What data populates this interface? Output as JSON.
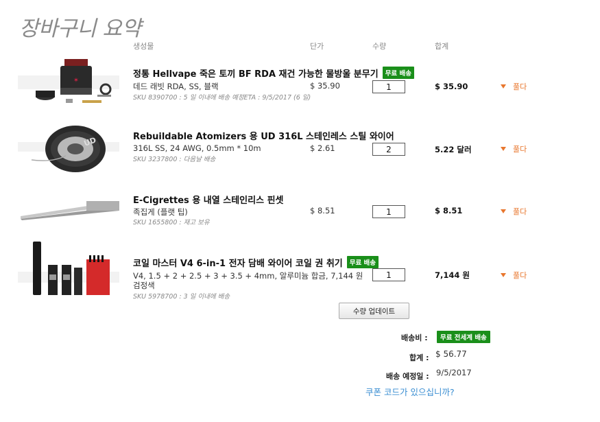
{
  "page": {
    "title": "장바구니 요약"
  },
  "columns": {
    "product": "생성물",
    "unit_price": "단가",
    "quantity": "수량",
    "total": "합계"
  },
  "items": [
    {
      "name": "정통 Hellvape 죽은 토끼 BF RDA 재건 가능한 물방울 분무기",
      "badge": "무료 배송",
      "variant": "데드 래빗 RDA, SS, 블랙",
      "sku": "SKU 8390700 : 5 일 이내에 배송 예정ETA : 9/5/2017 (6 일)",
      "price": "$ 35.90",
      "qty": "1",
      "total": "$ 35.90",
      "remove": "풀다",
      "image": "rda-atomizer-image"
    },
    {
      "name": "Rebuildable Atomizers 용 UD 316L 스테인레스 스틸 와이어",
      "badge": "",
      "variant": "316L SS, 24 AWG, 0.5mm * 10m",
      "sku": "SKU 3237800 : 다음날 배송",
      "price": "$ 2.61",
      "qty": "2",
      "total": "5.22 달러",
      "remove": "풀다",
      "image": "wire-spool-image"
    },
    {
      "name": "E-Cigrettes 용 내열 스테인리스 핀셋",
      "badge": "",
      "variant": "족집게 (플랫 팁)",
      "sku": "SKU 1655800 : 재고 보유",
      "price": "$ 8.51",
      "qty": "1",
      "total": "$ 8.51",
      "remove": "풀다",
      "image": "tweezers-image"
    },
    {
      "name": "코일 마스터 V4 6-in-1 전자 담배 와이어 코일 권 취기",
      "badge": "무료 배송",
      "variant": "V4, 1.5 + 2 + 2.5 + 3 + 3.5 + 4mm, 알루미늄 합금, 7,144 원",
      "variant2": "검정색",
      "sku": "SKU 5978700 : 3 일 이내에 배송",
      "price": "",
      "qty": "1",
      "total": "7,144 원",
      "remove": "풀다",
      "image": "coil-jig-image"
    }
  ],
  "update_button": "수량 업데이트",
  "summary": {
    "shipping_label": "배송비 :",
    "shipping_badge": "무료 전세계 배송",
    "total_label": "합계 :",
    "total_value": "$ 56.77",
    "eta_label": "배송 예정일 :",
    "eta_value": "9/5/2017",
    "coupon_link": "쿠폰 코드가 있으십니까?"
  },
  "colors": {
    "badge": "#1a8f1a",
    "remove": "#e8772e",
    "link": "#3a8ed2",
    "title": "#8a8a8a"
  }
}
